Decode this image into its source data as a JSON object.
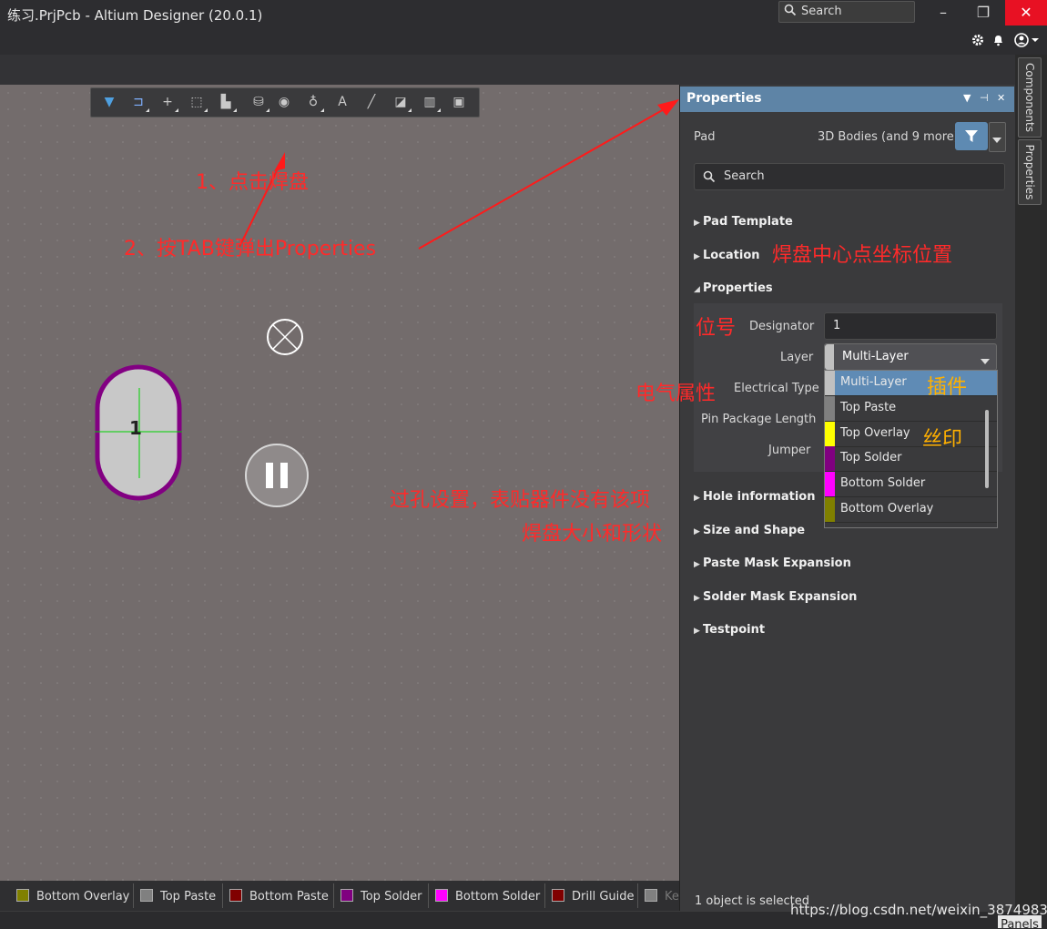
{
  "window": {
    "title": "练习.PrjPcb - Altium Designer (20.0.1)",
    "search_placeholder": "Search",
    "minimize_label": "–",
    "restore_label": "❐",
    "close_label": "✕"
  },
  "header_icons": [
    "gear-icon",
    "bell-icon",
    "user-icon"
  ],
  "right_tabs": [
    "Components",
    "Properties"
  ],
  "panel": {
    "title": "Properties",
    "object_type": "Pad",
    "filter_summary": "3D Bodies (and 9 more)",
    "search_placeholder": "Search",
    "sections": {
      "pad_template": "Pad Template",
      "location": "Location",
      "properties": "Properties",
      "hole_information": "Hole information",
      "size_and_shape": "Size and Shape",
      "paste_mask_expansion": "Paste Mask Expansion",
      "solder_mask_expansion": "Solder Mask Expansion",
      "testpoint": "Testpoint"
    },
    "fields": {
      "designator_label": "Designator",
      "designator_value": "1",
      "layer_label": "Layer",
      "layer_value": "Multi-Layer",
      "electrical_type_label": "Electrical Type",
      "pin_package_length_label": "Pin Package Length",
      "jumper_label": "Jumper"
    },
    "layer_options": [
      {
        "label": "Multi-Layer",
        "color": "#c0c0c0",
        "selected": true
      },
      {
        "label": "Top Paste",
        "color": "#808080",
        "selected": false
      },
      {
        "label": "Top Overlay",
        "color": "#ffff00",
        "selected": false
      },
      {
        "label": "Top Solder",
        "color": "#800080",
        "selected": false
      },
      {
        "label": "Bottom Solder",
        "color": "#ff00ff",
        "selected": false
      },
      {
        "label": "Bottom Overlay",
        "color": "#808000",
        "selected": false
      }
    ],
    "status": "1 object is selected"
  },
  "layer_tabs": [
    {
      "label": "Bottom Overlay",
      "color": "#808000"
    },
    {
      "label": "Top Paste",
      "color": "#808080"
    },
    {
      "label": "Bottom Paste",
      "color": "#800000"
    },
    {
      "label": "Top Solder",
      "color": "#800080"
    },
    {
      "label": "Bottom Solder",
      "color": "#ff00ff"
    },
    {
      "label": "Drill Guide",
      "color": "#800000"
    },
    {
      "label": "Ke",
      "color": "#808080"
    }
  ],
  "annotations": {
    "step1": "1、点击焊盘",
    "step2": "2、按TAB键弹出Properties",
    "location_note": "焊盘中心点坐标位置",
    "designator_note": "位号",
    "electrical_note": "电气属性",
    "multilayer_note": "插件",
    "overlay_note": "丝印",
    "hole_note": "过孔设置，表贴器件没有该项",
    "size_note": "焊盘大小和形状"
  },
  "pad_label": "1",
  "watermark": "https://blog.csdn.net/weixin_38749834",
  "panels_button": "Panels"
}
